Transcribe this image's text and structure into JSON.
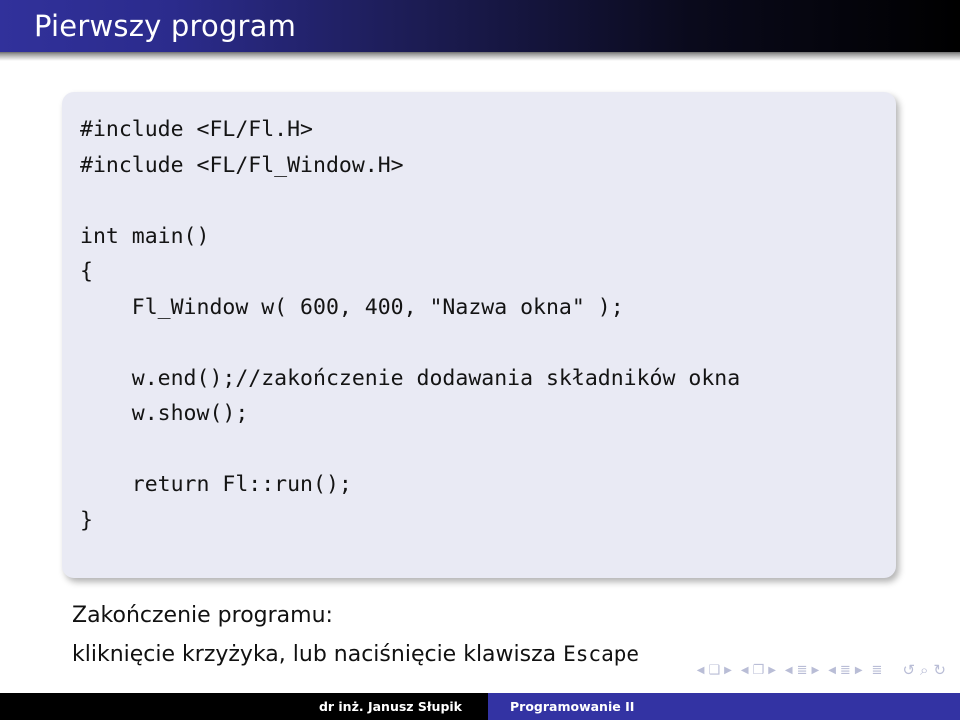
{
  "slide": {
    "title": "Pierwszy program",
    "accent_blue": "#3333a3",
    "header_gradient_from": "#31319b",
    "header_gradient_to": "#000000",
    "code_block_bg": "#e9eaf4"
  },
  "code": {
    "language": "cpp",
    "lines": [
      "#include <FL/Fl.H>",
      "#include <FL/Fl_Window.H>",
      "",
      "int main()",
      "{",
      "    Fl_Window w( 600, 400, \"Nazwa okna\" );",
      "",
      "    w.end();//zakończenie dodawania składników okna",
      "    w.show();",
      "",
      "    return Fl::run();",
      "}"
    ],
    "text": "#include <FL/Fl.H>\n#include <FL/Fl_Window.H>\n\nint main()\n{\n    Fl_Window w( 600, 400, \"Nazwa okna\" );\n\n    w.end();//zakończenie dodawania składników okna\n    w.show();\n\n    return Fl::run();\n}"
  },
  "outro": {
    "line1": "Zakończenie programu:",
    "line2_prefix": "kliknięcie krzyżyka, lub naciśnięcie klawisza ",
    "line2_mono": "Escape"
  },
  "navigation": {
    "groups": [
      {
        "prev": "◀",
        "symbol": "❑",
        "next": "▶",
        "name": "frame"
      },
      {
        "prev": "◀",
        "symbol": "❐",
        "next": "▶",
        "name": "subsection"
      },
      {
        "prev": "◀",
        "symbol": "≣",
        "next": "▶",
        "name": "section"
      },
      {
        "prev": "◀",
        "symbol": "≣",
        "next": "▶",
        "name": "part"
      }
    ],
    "single_symbol": "≣",
    "back": "↺",
    "search": "⌕",
    "forward": "↻"
  },
  "footer": {
    "author": "dr inż. Janusz Słupik",
    "course": "Programowanie II"
  }
}
